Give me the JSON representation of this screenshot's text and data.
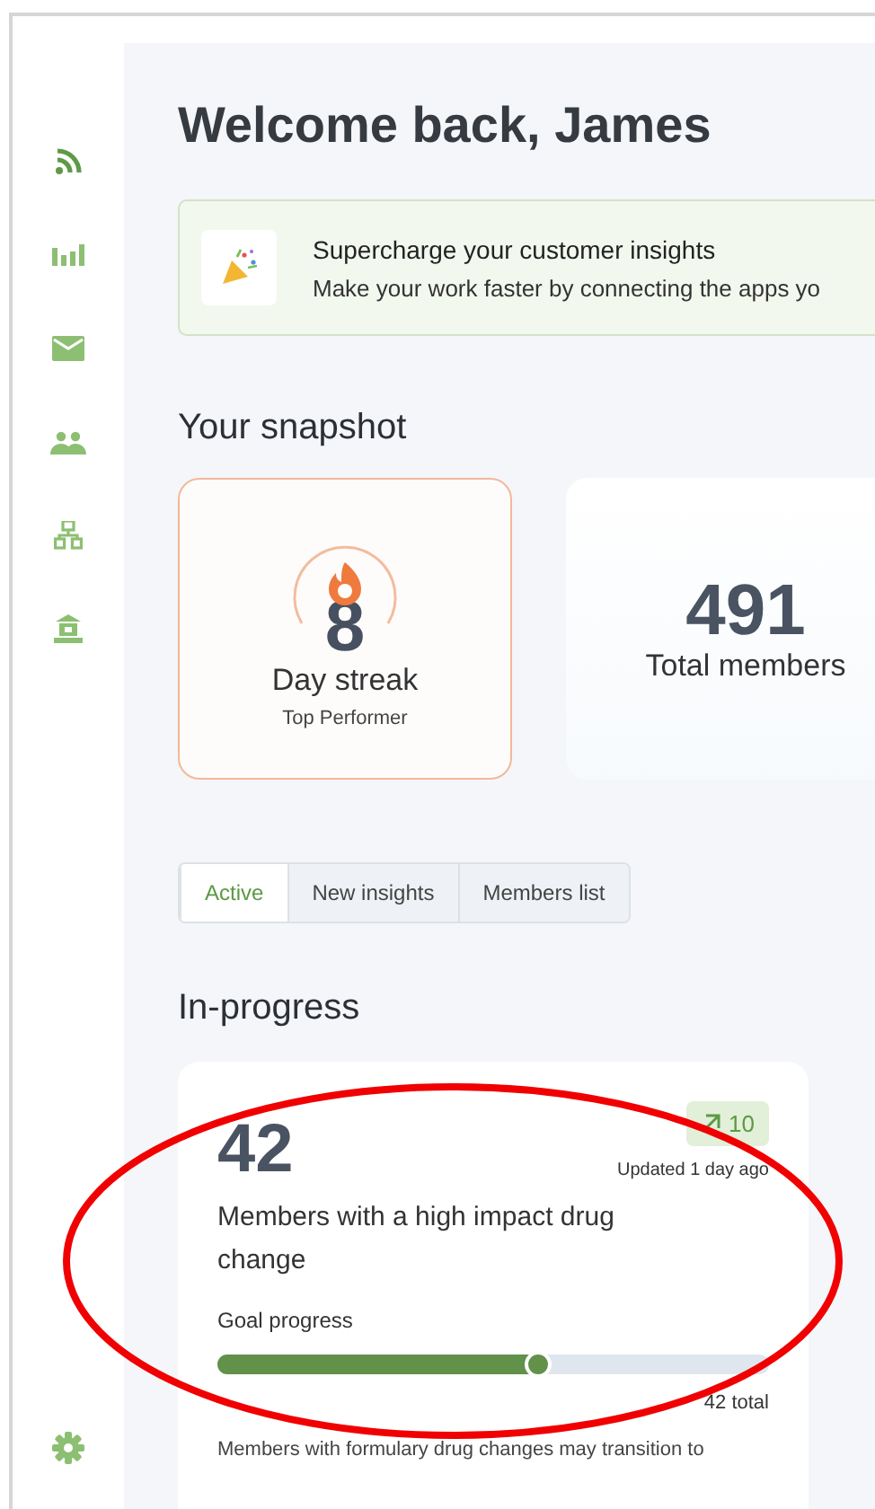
{
  "greeting": "Welcome back, James",
  "banner": {
    "title": "Supercharge your customer insights",
    "text": "Make your work faster by connecting the apps yo"
  },
  "snapshot": {
    "heading": "Your snapshot",
    "streak": {
      "value": "8",
      "label": "Day streak",
      "sublabel": "Top Performer"
    },
    "total": {
      "value": "491",
      "label": "Total members"
    }
  },
  "tabs": [
    {
      "label": "Active",
      "selected": true
    },
    {
      "label": "New insights",
      "selected": false
    },
    {
      "label": "Members list",
      "selected": false
    }
  ],
  "in_progress": {
    "heading": "In-progress",
    "card": {
      "value": "42",
      "badge": "10",
      "updated": "Updated 1 day ago",
      "title": "Members with a high impact drug change",
      "goal_label": "Goal progress",
      "level": 0.58,
      "total": "42 total",
      "description": "Members with formulary drug changes may transition to"
    }
  },
  "annotation": {
    "kind": "ellipse"
  }
}
